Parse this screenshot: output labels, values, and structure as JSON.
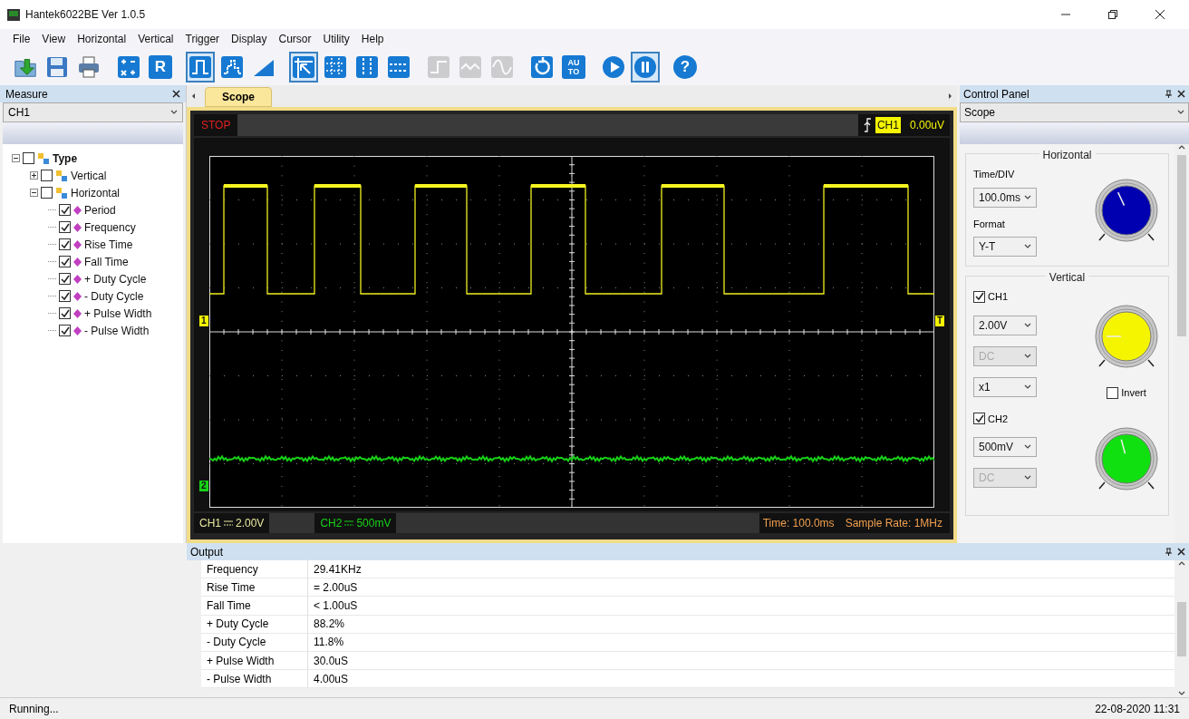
{
  "window": {
    "title": "Hantek6022BE Ver 1.0.5"
  },
  "menu": [
    "File",
    "View",
    "Horizontal",
    "Vertical",
    "Trigger",
    "Display",
    "Cursor",
    "Utility",
    "Help"
  ],
  "toolbar": [
    {
      "kind": "open",
      "selected": false,
      "disabled": false
    },
    {
      "kind": "save",
      "selected": false,
      "disabled": false
    },
    {
      "kind": "print",
      "selected": false,
      "disabled": false
    },
    {
      "kind": "math",
      "selected": false,
      "disabled": false
    },
    {
      "kind": "letter",
      "label": "R",
      "selected": false,
      "disabled": false
    },
    {
      "kind": "pulse",
      "selected": true,
      "disabled": false
    },
    {
      "kind": "steps",
      "selected": false,
      "disabled": false
    },
    {
      "kind": "ramp",
      "selected": false,
      "disabled": false
    },
    {
      "kind": "pointer",
      "selected": true,
      "disabled": false
    },
    {
      "kind": "grid",
      "selected": false,
      "disabled": false
    },
    {
      "kind": "vcursor",
      "selected": false,
      "disabled": false
    },
    {
      "kind": "hcursor",
      "selected": false,
      "disabled": false
    },
    {
      "kind": "step",
      "selected": false,
      "disabled": true
    },
    {
      "kind": "wave",
      "selected": false,
      "disabled": true
    },
    {
      "kind": "sine",
      "selected": false,
      "disabled": true
    },
    {
      "kind": "reset",
      "selected": false,
      "disabled": false
    },
    {
      "kind": "letter",
      "label": "AU TO",
      "selected": false,
      "disabled": false
    },
    {
      "kind": "play",
      "selected": false,
      "disabled": false
    },
    {
      "kind": "pause",
      "selected": true,
      "disabled": false
    },
    {
      "kind": "help",
      "label": "?",
      "selected": false,
      "disabled": false
    }
  ],
  "measure": {
    "title": "Measure",
    "channel": "CH1",
    "tree": [
      {
        "label": "Type",
        "checked": false,
        "expanded": true,
        "children": [
          {
            "label": "Vertical",
            "checked": false,
            "expanded": false
          },
          {
            "label": "Horizontal",
            "checked": false,
            "expanded": true,
            "children": [
              {
                "label": "Period",
                "checked": true
              },
              {
                "label": "Frequency",
                "checked": true
              },
              {
                "label": "Rise Time",
                "checked": true
              },
              {
                "label": "Fall Time",
                "checked": true
              },
              {
                "label": "+ Duty Cycle",
                "checked": true
              },
              {
                "label": "- Duty Cycle",
                "checked": true
              },
              {
                "label": "+ Pulse Width",
                "checked": true
              },
              {
                "label": "- Pulse Width",
                "checked": true
              }
            ]
          }
        ]
      }
    ]
  },
  "scope": {
    "tab": "Scope",
    "status": "STOP",
    "trigger_channel": "CH1",
    "trigger_level": "0.00uV",
    "ch1_marker": "1",
    "ch2_marker": "2",
    "trigger_marker": "T",
    "ch1_label": "CH1",
    "ch1_scale": "2.00V",
    "ch2_label": "CH2",
    "ch2_scale": "500mV",
    "time": "Time: 100.0ms",
    "sample_rate": "Sample Rate: 1MHz"
  },
  "control_panel": {
    "title": "Control Panel",
    "mode": "Scope",
    "horizontal": {
      "title": "Horizontal",
      "time_div_label": "Time/DIV",
      "time_div": "100.0ms",
      "format_label": "Format",
      "format": "Y-T",
      "color": "#0000b0"
    },
    "vertical": {
      "title": "Vertical",
      "channels": [
        {
          "label": "CH1",
          "checked": true,
          "scale": "2.00V",
          "coupling": "DC",
          "probe": "x1",
          "invert": {
            "label": "Invert",
            "checked": false
          },
          "color": "#f5f500"
        },
        {
          "label": "CH2",
          "checked": true,
          "scale": "500mV",
          "coupling": "DC",
          "color": "#10e010"
        }
      ]
    }
  },
  "output": {
    "title": "Output",
    "rows": [
      {
        "name": "Frequency",
        "value": "29.41KHz"
      },
      {
        "name": "Rise Time",
        "value": "= 2.00uS"
      },
      {
        "name": "Fall Time",
        "value": "< 1.00uS"
      },
      {
        "name": "+ Duty Cycle",
        "value": "88.2%"
      },
      {
        "name": "- Duty Cycle",
        "value": "11.8%"
      },
      {
        "name": "+ Pulse Width",
        "value": "30.0uS"
      },
      {
        "name": "- Pulse Width",
        "value": "4.00uS"
      }
    ]
  },
  "status_bar": {
    "state": "Running...",
    "datetime": "22-08-2020 11:31"
  }
}
